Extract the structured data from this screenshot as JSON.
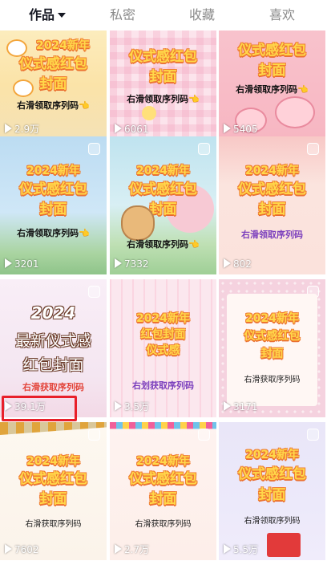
{
  "tabs": [
    {
      "label": "作品",
      "active": true
    },
    {
      "label": "私密",
      "active": false
    },
    {
      "label": "收藏",
      "active": false
    },
    {
      "label": "喜欢",
      "active": false
    }
  ],
  "videos": [
    {
      "lines": [
        "2024新年",
        "仪式感红包",
        "封面"
      ],
      "sub": "右滑领取序列码👈",
      "views": "2.9万"
    },
    {
      "lines": [
        "仪式感红包",
        "封面"
      ],
      "sub": "右滑领取序列码👈",
      "views": "6061"
    },
    {
      "lines": [
        "仪式感红包",
        "封面"
      ],
      "sub": "右滑领取序列码👈",
      "views": "5405"
    },
    {
      "lines": [
        "2024新年",
        "仪式感红包",
        "封面"
      ],
      "sub": "右滑领取序列码👈",
      "views": "3201"
    },
    {
      "lines": [
        "2024新年",
        "仪式感红包",
        "封面"
      ],
      "sub": "右滑领取序列码👈",
      "views": "7332"
    },
    {
      "lines": [
        "2024新年",
        "仪式感红包",
        "封面"
      ],
      "sub": "右滑领取序列码",
      "views": "802"
    },
    {
      "lines": [
        "2024",
        "最新仪式感",
        "红包封面"
      ],
      "sub": "右滑获取序列码",
      "views": "39.1万"
    },
    {
      "lines": [
        "2024新年",
        "红包封面",
        "仪式感"
      ],
      "sub": "右划获取序列码",
      "views": "3.5万"
    },
    {
      "lines": [
        "2024新年",
        "仪式感红包",
        "封面"
      ],
      "sub": "右滑获取序列码",
      "views": "3171"
    },
    {
      "lines": [
        "2024新年",
        "仪式感红包",
        "封面"
      ],
      "sub": "右滑获取序列码",
      "views": "7602"
    },
    {
      "lines": [
        "2024新年",
        "仪式感红包",
        "封面"
      ],
      "sub": "右滑获取序列码",
      "views": "2.7万"
    },
    {
      "lines": [
        "2024新年",
        "仪式感红包",
        "封面"
      ],
      "sub": "右滑领取序列码",
      "views": "5.5万"
    }
  ],
  "colors": {
    "highlight_box": "#e8202a",
    "title_fill": "#ffd84a",
    "title_outline": "#f07c31"
  }
}
